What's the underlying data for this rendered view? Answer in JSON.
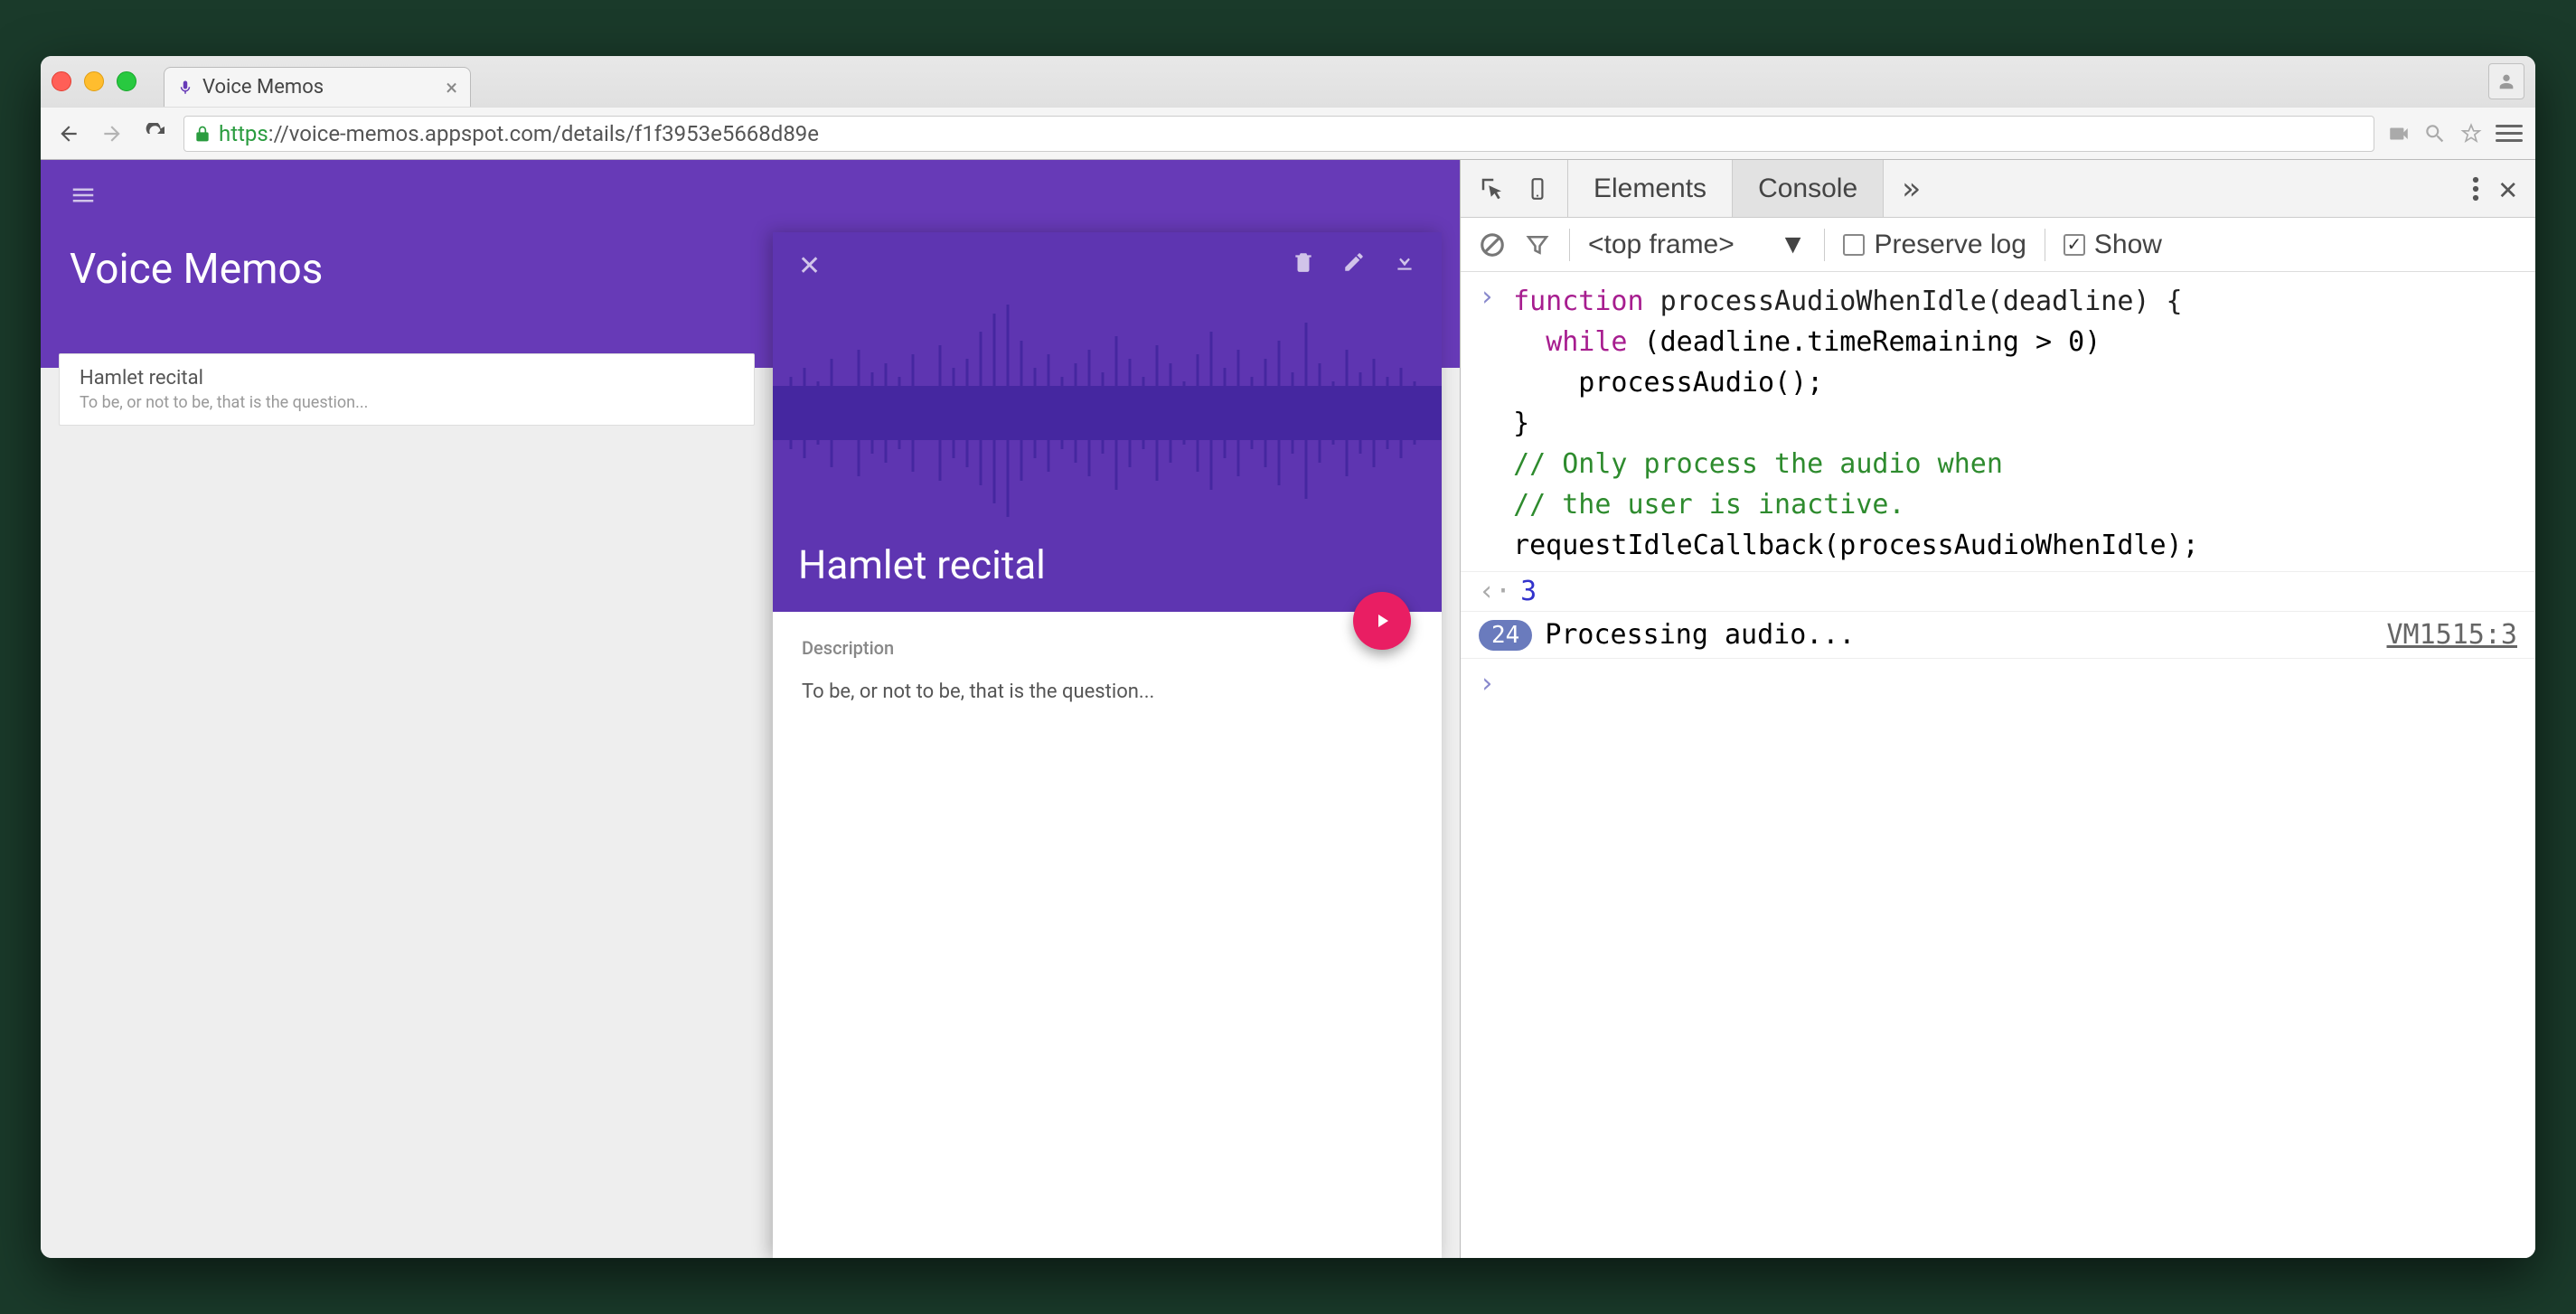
{
  "tab": {
    "title": "Voice Memos"
  },
  "url": {
    "secure_part": "https",
    "rest": "://voice-memos.appspot.com/details/f1f3953e5668d89e"
  },
  "app": {
    "title": "Voice Memos",
    "list": [
      {
        "title": "Hamlet recital",
        "subtitle": "To be, or not to be, that is the question..."
      }
    ],
    "detail": {
      "title": "Hamlet recital",
      "description_label": "Description",
      "description_text": "To be, or not to be, that is the question..."
    }
  },
  "devtools": {
    "tabs": {
      "elements": "Elements",
      "console": "Console"
    },
    "frame_label": "<top frame>",
    "preserve_label": "Preserve log",
    "show_label": "Show",
    "code": {
      "l1": "function processAudioWhenIdle(deadline) {",
      "l2": "  while (deadline.timeRemaining > 0)",
      "l3": "    processAudio();",
      "l4": "}",
      "l5": "",
      "l6": "// Only process the audio when",
      "l7": "// the user is inactive.",
      "l8": "requestIdleCallback(processAudioWhenIdle);"
    },
    "return_value": "3",
    "log": {
      "count": "24",
      "message": "Processing audio...",
      "source": "VM1515:3"
    }
  }
}
